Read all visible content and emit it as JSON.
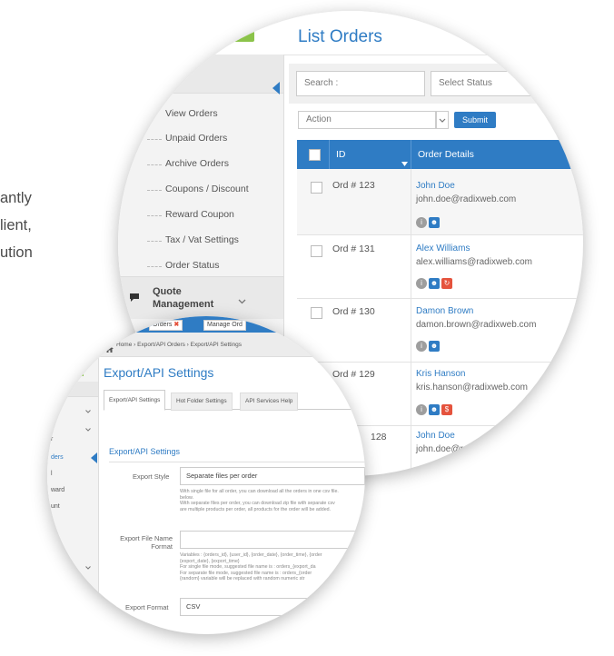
{
  "background_text": [
    "antly",
    "lient,",
    "ution"
  ],
  "list_orders": {
    "badge_label": "✉?",
    "title": "List Orders",
    "search_placeholder": "Search :",
    "status_select": "Select Status",
    "action_select": "Action",
    "submit_label": "Submit",
    "columns": [
      "ID",
      "Order Details"
    ],
    "sidebar": {
      "items": [
        {
          "label": "View Orders"
        },
        {
          "label": "Unpaid Orders"
        },
        {
          "label": "Archive Orders"
        },
        {
          "label": "Coupons / Discount"
        },
        {
          "label": "Reward Coupon"
        },
        {
          "label": "Tax / Vat Settings"
        },
        {
          "label": "Order Status"
        }
      ],
      "quote_line1": "Quote",
      "quote_line2": "Management"
    },
    "rows": [
      {
        "id": "Ord # 123",
        "name": "John Doe",
        "email": "john.doe@radixweb.com"
      },
      {
        "id": "Ord # 131",
        "name": "Alex Williams",
        "email": "alex.williams@radixweb.com"
      },
      {
        "id": "Ord # 130",
        "name": "Damon Brown",
        "email": "damon.brown@radixweb.com"
      },
      {
        "id": "Ord # 129",
        "name": "Kris Hanson",
        "email": "kris.hanson@radixweb.com"
      },
      {
        "id": "128",
        "name": "John Doe",
        "email": "john.doe@rad"
      }
    ],
    "colors": {
      "accent": "#2f7cc4",
      "badge": "#8bc34a",
      "gray_icon": "#9e9e9e",
      "red_icon": "#e5533d"
    }
  },
  "export_settings": {
    "open_tabs": [
      "Orders",
      "Manage Ord"
    ],
    "breadcrumb": "Home › Export/API Orders › Export/API Settings",
    "title": "Export/API Settings",
    "tabs": [
      "Export/API Settings",
      "Hot Folder Settings",
      "API Services Help"
    ],
    "section_title": "Export/API Settings",
    "sidebar_fragments": [
      "r",
      "ders",
      "l",
      "ward",
      "unt",
      "s",
      "ment"
    ],
    "fields": [
      {
        "label": "Export Style",
        "value": "Separate files per order",
        "help": [
          "With single file for all order, you can download all the orders in one csv file.",
          "below.",
          "With separate files per order, you can download zip file with separate csv",
          "are multiple products per order, all products for the order will be added."
        ]
      },
      {
        "label_line1": "Export File Name",
        "label_line2": "Format",
        "value": "",
        "help": [
          "Variables : {orders_id}, {user_id}, {order_date}, {order_time}, {order",
          "{export_date}, {export_time}",
          "For single file mode, suggested file name is : orders_{export_da",
          "For separate file mode, suggested file name is : orders_{order",
          "{random} variable will be replaced with random numeric str"
        ]
      },
      {
        "label": "Export Format",
        "value": "CSV"
      }
    ]
  }
}
